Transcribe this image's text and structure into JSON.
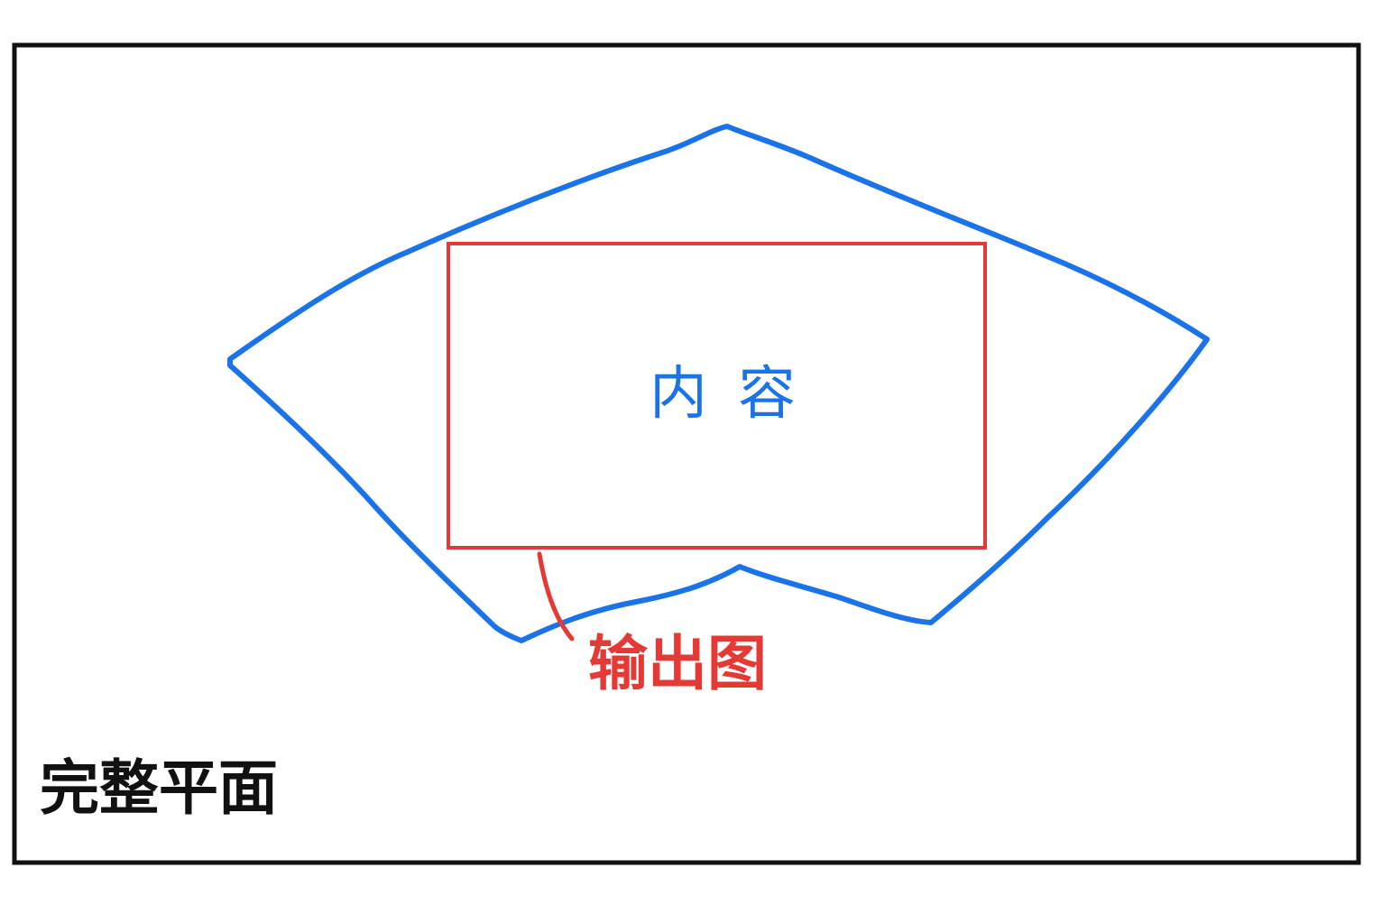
{
  "labels": {
    "full_plane": "完整平面",
    "content": "内容",
    "output_image": "输出图"
  },
  "colors": {
    "frame": "#111111",
    "content_outline": "#1a73e8",
    "output_box": "#e53935",
    "full_plane_text": "#111111"
  }
}
